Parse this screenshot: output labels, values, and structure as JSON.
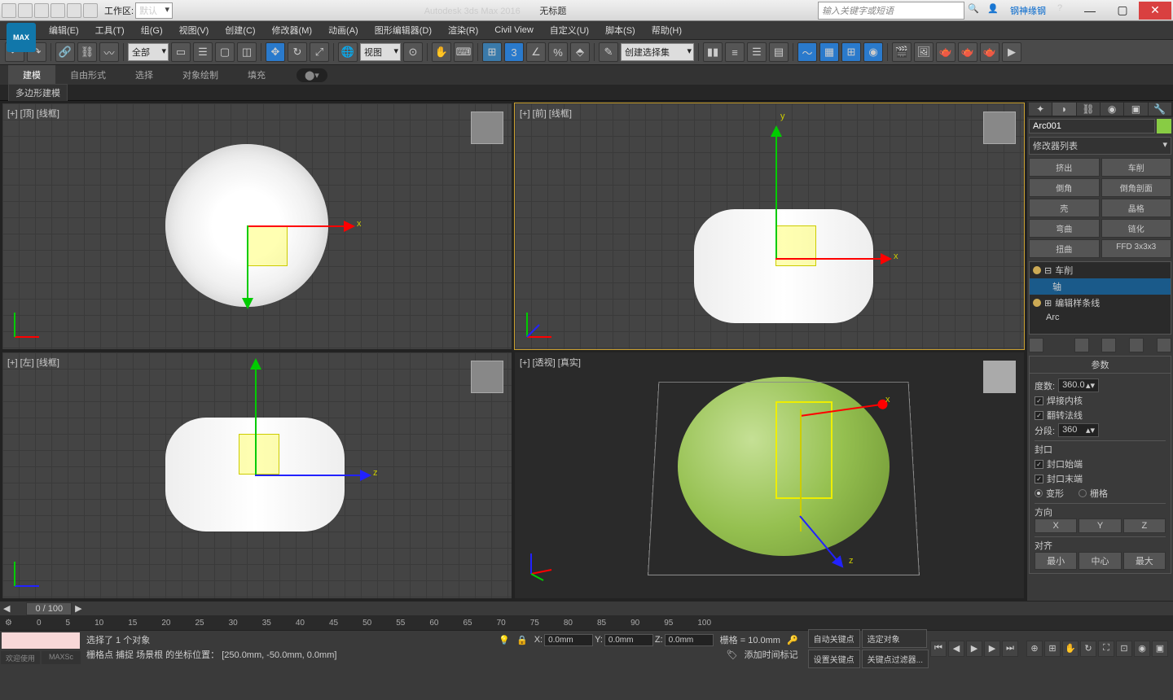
{
  "titlebar": {
    "workspace_label": "工作区:",
    "workspace_value": "默认",
    "app_title": "Autodesk 3ds Max 2016",
    "doc_title": "无标题",
    "search_placeholder": "输入关键字或短语",
    "username": "钢神缘钢"
  },
  "menubar": {
    "logo": "MAX",
    "items": [
      "编辑(E)",
      "工具(T)",
      "组(G)",
      "视图(V)",
      "创建(C)",
      "修改器(M)",
      "动画(A)",
      "图形编辑器(D)",
      "渲染(R)",
      "Civil View",
      "自定义(U)",
      "脚本(S)",
      "帮助(H)"
    ]
  },
  "toolbar": {
    "all_dd": "全部",
    "view_dd": "视图",
    "snap_num": "3",
    "named_sel": "创建选择集"
  },
  "ribbon": {
    "tabs": [
      "建模",
      "自由形式",
      "选择",
      "对象绘制",
      "填充"
    ],
    "sub": "多边形建模"
  },
  "viewports": {
    "top": "[+] [顶] [线框]",
    "front": "[+] [前] [线框]",
    "left": "[+] [左] [线框]",
    "persp": "[+] [透视] [真实]",
    "axis_x": "x",
    "axis_y": "y",
    "axis_z": "z"
  },
  "cmdpanel": {
    "obj_name": "Arc001",
    "mod_list": "修改器列表",
    "buttons": [
      "挤出",
      "车削",
      "倒角",
      "倒角剖面",
      "壳",
      "晶格",
      "弯曲",
      "链化",
      "扭曲",
      "FFD 3x3x3"
    ],
    "stack": {
      "lathe": "车削",
      "axis": "轴",
      "editspline": "编辑样条线",
      "arc": "Arc"
    },
    "rollout_params": "参数",
    "degrees_lbl": "度数:",
    "degrees_val": "360.0",
    "weld_lbl": "焊接内核",
    "flip_lbl": "翻转法线",
    "segs_lbl": "分段:",
    "segs_val": "360",
    "cap_hdr": "封口",
    "cap_start": "封口始端",
    "cap_end": "封口末端",
    "morph": "变形",
    "grid": "栅格",
    "dir_hdr": "方向",
    "dir_x": "X",
    "dir_y": "Y",
    "dir_z": "Z",
    "align_hdr": "对齐",
    "align_btns": [
      "最小",
      "中心",
      "最大"
    ]
  },
  "timeslider": {
    "pos": "0 / 100"
  },
  "trackbar": {
    "ticks": [
      "0",
      "5",
      "10",
      "15",
      "20",
      "25",
      "30",
      "35",
      "40",
      "45",
      "50",
      "55",
      "60",
      "65",
      "70",
      "75",
      "80",
      "85",
      "90",
      "95",
      "100"
    ]
  },
  "status": {
    "welcome": "欢迎使用",
    "maxs": "MAXSc",
    "line1": "选择了 1 个对象",
    "line2": "栅格点 捕捉 场景根 的坐标位置： [250.0mm, -50.0mm, 0.0mm]",
    "x_lbl": "X:",
    "x_val": "0.0mm",
    "y_lbl": "Y:",
    "y_val": "0.0mm",
    "z_lbl": "Z:",
    "z_val": "0.0mm",
    "grid_lbl": "栅格 = 10.0mm",
    "addtime": "添加时间标记",
    "autokey": "自动关键点",
    "selobj": "选定对象",
    "setkey": "设置关键点",
    "keyfilter": "关键点过滤器..."
  }
}
